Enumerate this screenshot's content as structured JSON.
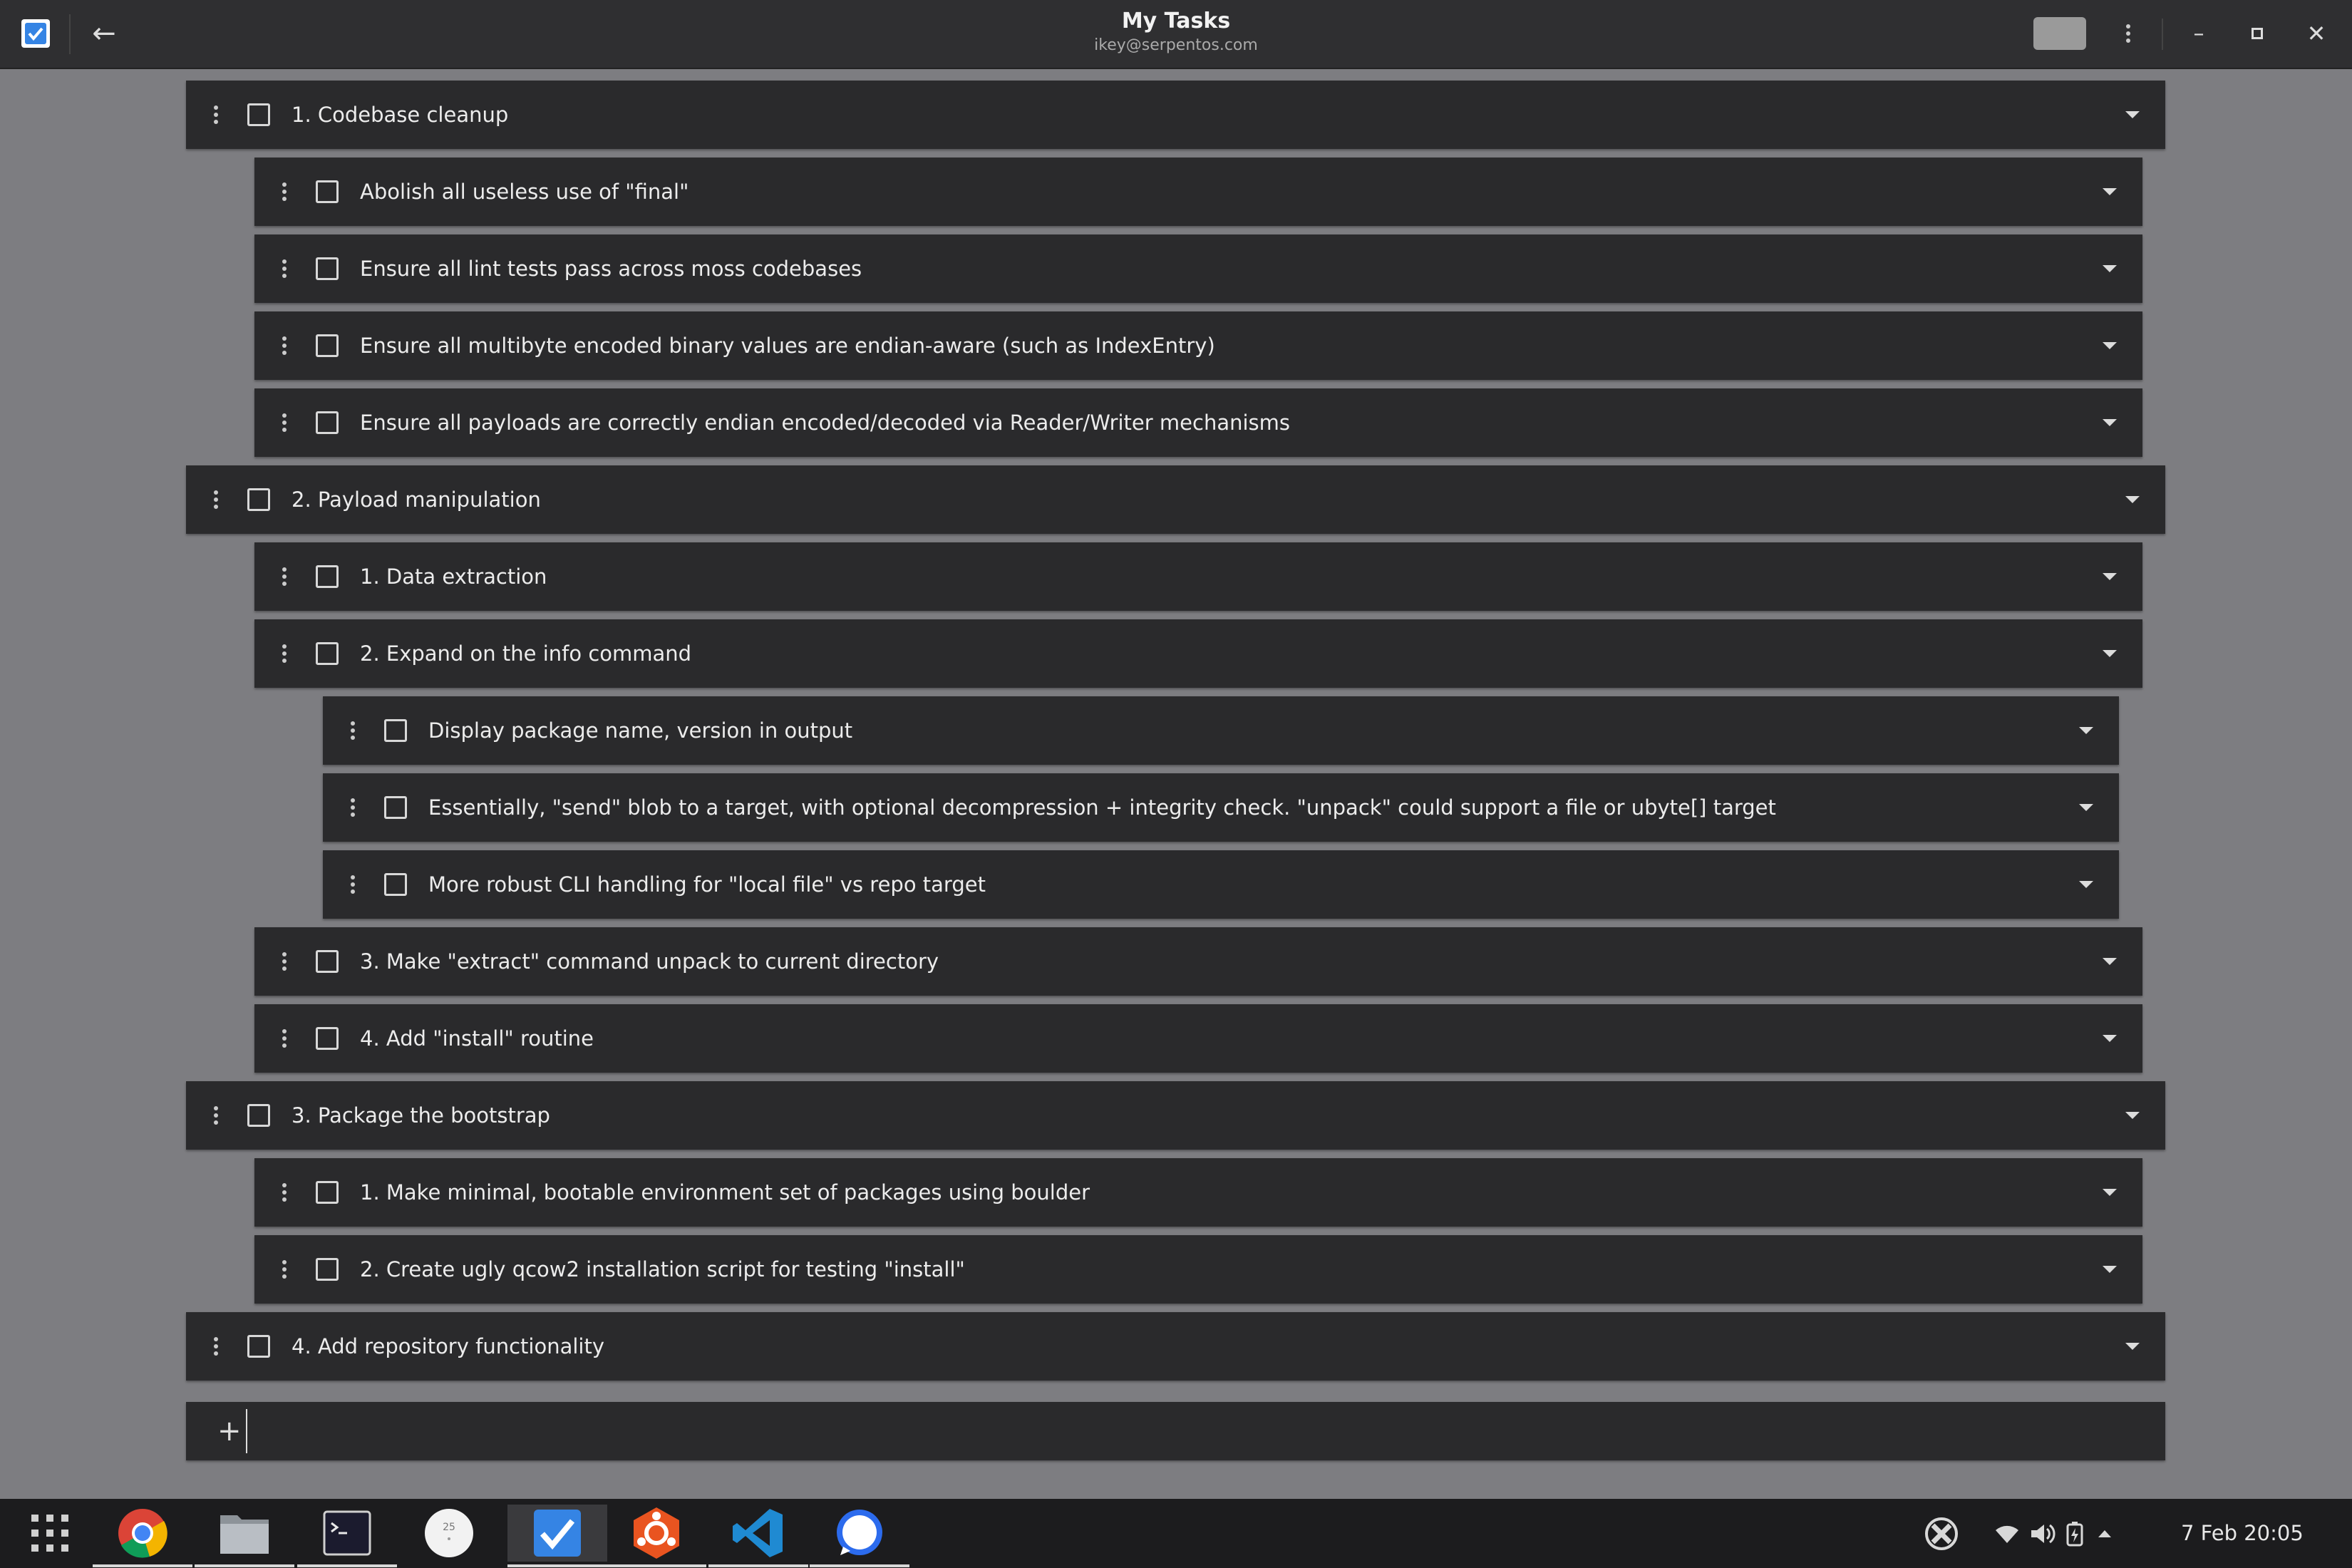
{
  "window": {
    "title": "My Tasks",
    "account": "ikey@serpentos.com"
  },
  "tasks": [
    {
      "level": 1,
      "label": "1. Codebase cleanup",
      "checked": false
    },
    {
      "level": 2,
      "label": "Abolish all useless use of \"final\"",
      "checked": false
    },
    {
      "level": 2,
      "label": "Ensure all lint tests pass across moss codebases",
      "checked": false
    },
    {
      "level": 2,
      "label": "Ensure all multibyte encoded binary values are endian-aware (such as IndexEntry)",
      "checked": false
    },
    {
      "level": 2,
      "label": "Ensure all payloads are correctly endian encoded/decoded via Reader/Writer mechanisms",
      "checked": false
    },
    {
      "level": 1,
      "label": "2. Payload manipulation",
      "checked": false
    },
    {
      "level": 2,
      "label": "1. Data extraction",
      "checked": false
    },
    {
      "level": 2,
      "label": "2. Expand on the info command",
      "checked": false
    },
    {
      "level": 3,
      "label": "Display package name, version in output",
      "checked": false
    },
    {
      "level": 3,
      "label": "Essentially, \"send\" blob to a target, with optional decompression + integrity check. \"unpack\" could support a file or ubyte[] target",
      "checked": false
    },
    {
      "level": 3,
      "label": "More robust CLI handling for \"local file\" vs repo target",
      "checked": false
    },
    {
      "level": 2,
      "label": "3. Make \"extract\" command unpack to current directory",
      "checked": false
    },
    {
      "level": 2,
      "label": "4. Add \"install\" routine",
      "checked": false
    },
    {
      "level": 1,
      "label": "3. Package the bootstrap",
      "checked": false
    },
    {
      "level": 2,
      "label": "1. Make minimal, bootable environment set of packages using boulder",
      "checked": false
    },
    {
      "level": 2,
      "label": "2. Create ugly qcow2 installation script for testing \"install\"",
      "checked": false
    },
    {
      "level": 1,
      "label": "4. Add repository functionality",
      "checked": false
    }
  ],
  "new_task": {
    "value": "",
    "placeholder": ""
  },
  "taskbar": {
    "apps": [
      {
        "icon": "app-grid-icon",
        "active": false
      },
      {
        "icon": "chrome-icon",
        "active": false
      },
      {
        "icon": "files-icon",
        "active": false
      },
      {
        "icon": "terminal-icon",
        "active": false
      },
      {
        "icon": "calendar-icon",
        "active": false,
        "text": "25"
      },
      {
        "icon": "tasks-icon",
        "active": true
      },
      {
        "icon": "ubuntu-icon",
        "active": false
      },
      {
        "icon": "vscode-icon",
        "active": false
      },
      {
        "icon": "signal-icon",
        "active": false
      }
    ],
    "clock": "7 Feb 20:05"
  },
  "colors": {
    "background": "#7d7d81",
    "header": "#2f2f31",
    "row": "#2a2a2c",
    "accent": "#3584e4"
  }
}
